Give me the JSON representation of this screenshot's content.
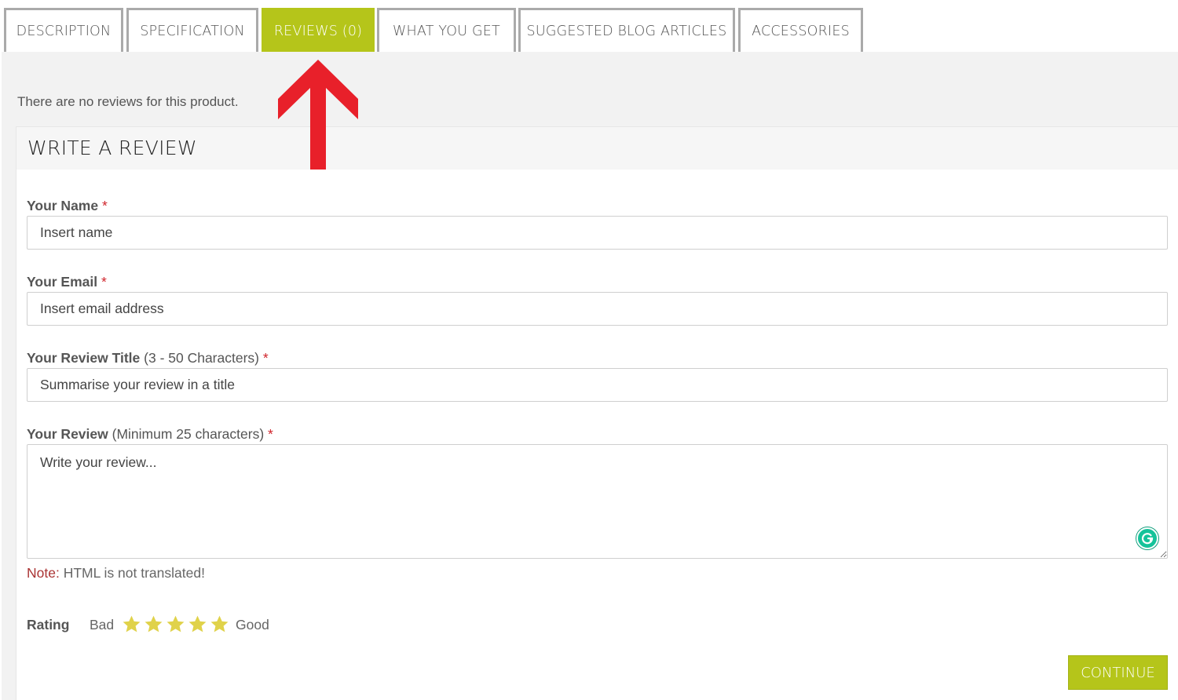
{
  "tabs": [
    {
      "label": "DESCRIPTION",
      "active": false
    },
    {
      "label": "SPECIFICATION",
      "active": false
    },
    {
      "label": "REVIEWS (0)",
      "active": true
    },
    {
      "label": "WHAT YOU GET",
      "active": false
    },
    {
      "label": "SUGGESTED BLOG ARTICLES",
      "active": false
    },
    {
      "label": "ACCESSORIES",
      "active": false
    }
  ],
  "no_reviews_text": "There are no reviews for this product.",
  "form": {
    "heading": "WRITE A REVIEW",
    "required_mark": "*",
    "name": {
      "label": "Your Name",
      "placeholder": "Insert name"
    },
    "email": {
      "label": "Your Email",
      "placeholder": "Insert email address"
    },
    "title": {
      "label": "Your Review Title",
      "hint": "(3 - 50 Characters)",
      "placeholder": "Summarise your review in a title"
    },
    "review": {
      "label": "Your Review",
      "hint": "(Minimum 25 characters)",
      "placeholder": "Write your review..."
    },
    "note": {
      "key": "Note:",
      "text": "HTML is not translated!"
    },
    "rating": {
      "label": "Rating",
      "low": "Bad",
      "high": "Good",
      "star_count": 5
    },
    "continue_label": "CONTINUE"
  },
  "colors": {
    "accent": "#b5c51a",
    "star": "#e0d24a",
    "arrow": "#e8202a",
    "required": "#d0232a",
    "grammarly": "#15c39a"
  },
  "icons": {
    "annotation": "red-up-arrow",
    "rating": "star-icon",
    "assistant": "grammarly-icon"
  }
}
